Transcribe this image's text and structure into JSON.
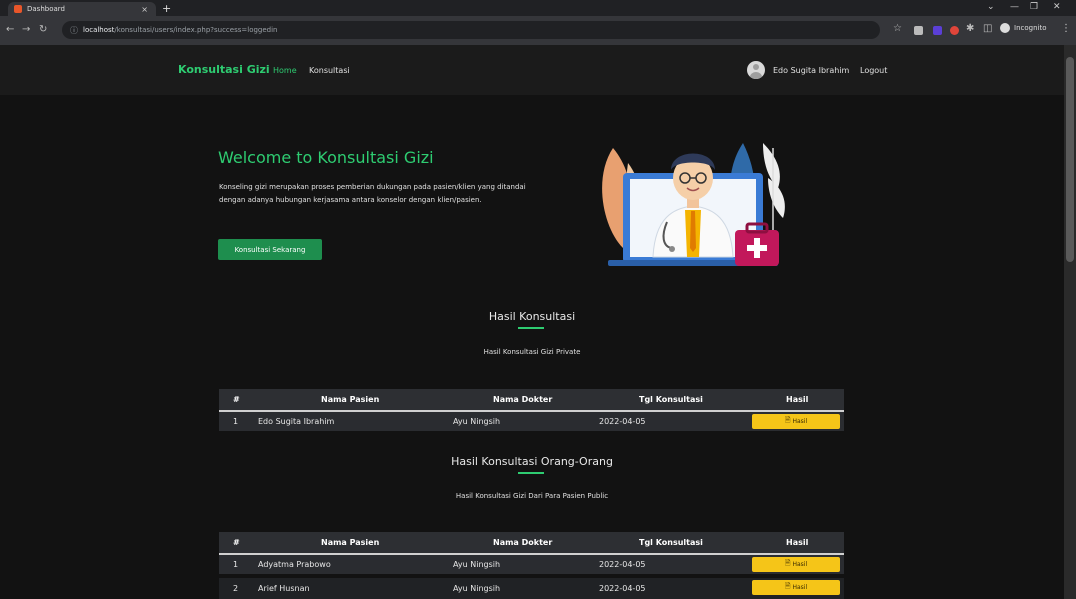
{
  "browser": {
    "tab_title": "Dashboard",
    "tab_close": "×",
    "new_tab": "+",
    "url_host": "localhost",
    "url_path": "/konsultasi/users/index.php?success=loggedin",
    "incognito_label": "Incognito"
  },
  "navbar": {
    "brand": "Konsultasi Gizi",
    "links": [
      "Home",
      "Konsultasi"
    ],
    "user_name": "Edo Sugita Ibrahim",
    "logout": "Logout"
  },
  "hero": {
    "title": "Welcome to Konsultasi Gizi",
    "description": "Konseling gizi merupakan proses pemberian dukungan pada pasien/klien yang ditandai dengan adanya hubungan kerjasama antara konselor dengan klien/pasien.",
    "button": "Konsultasi Sekarang"
  },
  "section_private": {
    "title": "Hasil Konsultasi",
    "subtitle": "Hasil Konsultasi Gizi Private",
    "columns": [
      "#",
      "Nama Pasien",
      "Nama Dokter",
      "Tgl Konsultasi",
      "Hasil"
    ],
    "rows": [
      {
        "num": "1",
        "pasien": "Edo Sugita Ibrahim",
        "dokter": "Ayu Ningsih",
        "tgl": "2022-04-05",
        "hasil": "Hasil"
      }
    ]
  },
  "section_public": {
    "title": "Hasil Konsultasi Orang-Orang",
    "subtitle": "Hasil Konsultasi Gizi Dari Para Pasien Public",
    "columns": [
      "#",
      "Nama Pasien",
      "Nama Dokter",
      "Tgl Konsultasi",
      "Hasil"
    ],
    "rows": [
      {
        "num": "1",
        "pasien": "Adyatma Prabowo",
        "dokter": "Ayu Ningsih",
        "tgl": "2022-04-05",
        "hasil": "Hasil"
      },
      {
        "num": "2",
        "pasien": "Arief Husnan",
        "dokter": "Ayu Ningsih",
        "tgl": "2022-04-05",
        "hasil": "Hasil"
      }
    ]
  },
  "colors": {
    "accent": "#2ecc71",
    "button_green": "#1e8e4e",
    "hasil_button": "#f5c518",
    "page_bg": "#121212"
  }
}
